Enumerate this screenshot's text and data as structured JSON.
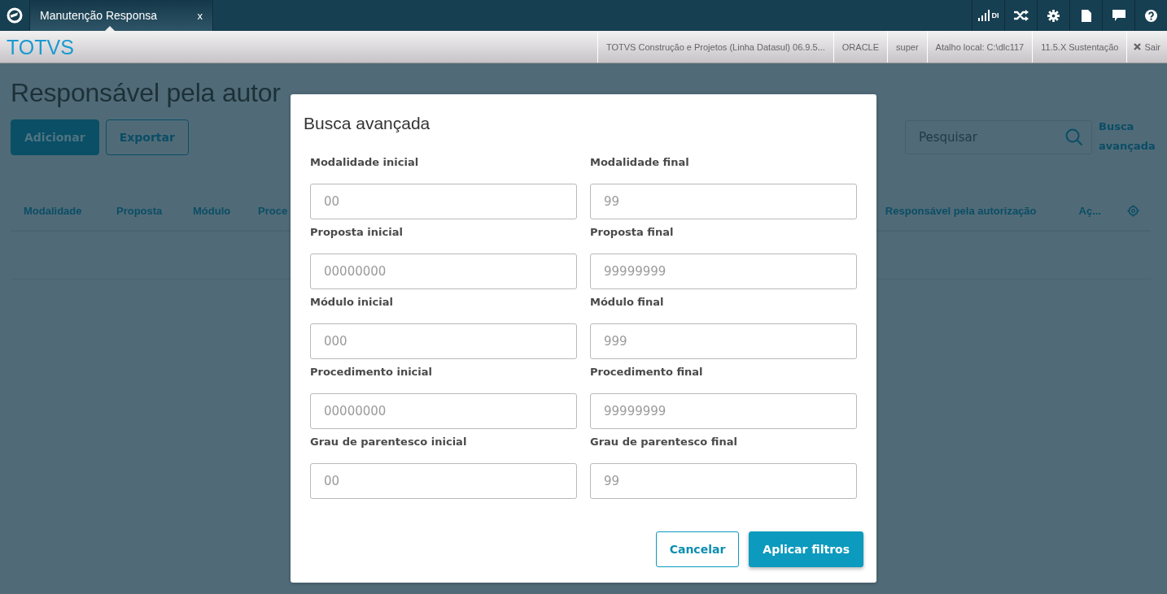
{
  "topbar": {
    "tab": {
      "label": "Manutenção Responsa",
      "close": "x",
      "selected": true
    },
    "signal_label": "DI"
  },
  "header": {
    "brand": "TOTVS",
    "items": [
      "TOTVS Construção e Projetos (Linha Datasul) 06.9.5...",
      "ORACLE",
      "super",
      "Atalho local: C:\\dlc117",
      "11.5.X Sustentação"
    ],
    "logout": "Sair"
  },
  "page": {
    "title": "Responsável pela autor",
    "buttons": [
      {
        "label": "Adicionar",
        "kind": "primary"
      },
      {
        "label": "Exportar",
        "kind": "secondary"
      }
    ],
    "search": {
      "placeholder": "Pesquisar"
    },
    "advanced_link": "Busca avançada",
    "columns_left": [
      "Modalidade",
      "Proposta",
      "Módulo",
      "Proce"
    ],
    "columns_right": [
      "Responsável pela autorização",
      "Aç..."
    ]
  },
  "dialog": {
    "title": "Busca avançada",
    "fields": [
      {
        "label": "Modalidade inicial",
        "placeholder": "00"
      },
      {
        "label": "Modalidade final",
        "placeholder": "99"
      },
      {
        "label": "Proposta inicial",
        "placeholder": "00000000"
      },
      {
        "label": "Proposta final",
        "placeholder": "99999999"
      },
      {
        "label": "Módulo inicial",
        "placeholder": "000"
      },
      {
        "label": "Módulo final",
        "placeholder": "999"
      },
      {
        "label": "Procedimento inicial",
        "placeholder": "00000000"
      },
      {
        "label": "Procedimento final",
        "placeholder": "99999999"
      },
      {
        "label": "Grau de parentesco inicial",
        "placeholder": "00"
      },
      {
        "label": "Grau de parentesco final",
        "placeholder": "99"
      }
    ],
    "buttons": [
      {
        "label": "Cancelar",
        "kind": "secondary"
      },
      {
        "label": "Aplicar filtros",
        "kind": "primary"
      }
    ]
  }
}
